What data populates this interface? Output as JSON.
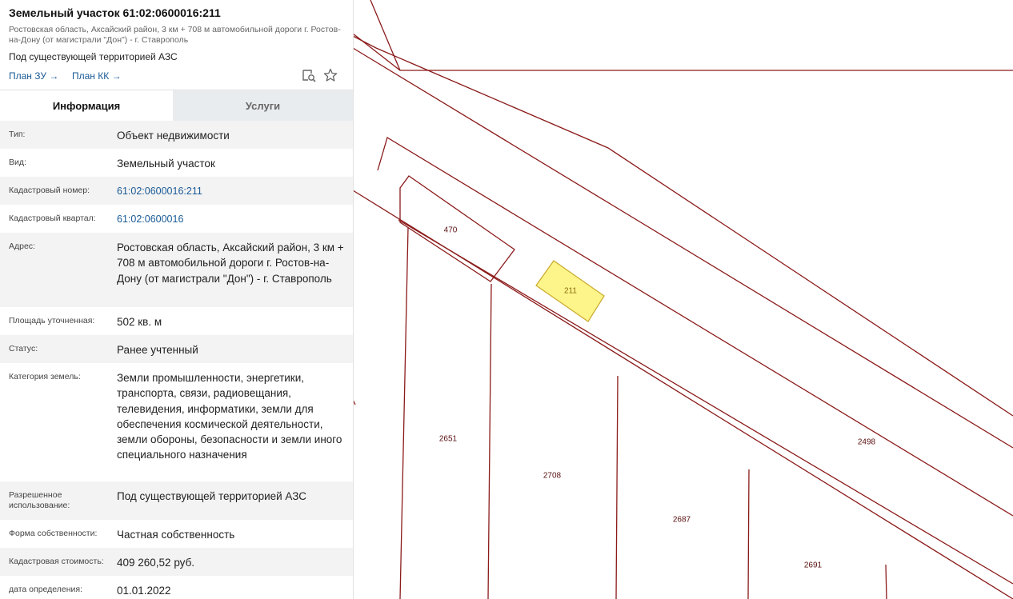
{
  "panel": {
    "title": "Земельный участок 61:02:0600016:211",
    "subaddress": "Ростовская область, Аксайский район, 3 км + 708 м автомобильной дороги г. Ростов-на-Дону (от магистрали \"Дон\") - г. Ставрополь",
    "usage": "Под существующей территорией АЗС",
    "links": [
      {
        "label": "План ЗУ →"
      },
      {
        "label": "План КК →"
      }
    ],
    "icons": [
      "map-search-icon",
      "star-icon"
    ],
    "tabs": [
      {
        "label": "Информация",
        "active": true
      },
      {
        "label": "Услуги",
        "active": false
      }
    ],
    "rows": [
      {
        "label": "Тип:",
        "value": "Объект недвижимости"
      },
      {
        "label": "Вид:",
        "value": "Земельный участок"
      },
      {
        "label": "Кадастровый номер:",
        "value": "61:02:0600016:211",
        "link": true
      },
      {
        "label": "Кадастровый квартал:",
        "value": "61:02:0600016",
        "link": true
      },
      {
        "label": "Адрес:",
        "value": "Ростовская область, Аксайский район, 3 км + 708 м автомобильной дороги г. Ростов-на-Дону (от магистрали \"Дон\") - г. Ставрополь"
      },
      {
        "label": "Площадь уточненная:",
        "value": "502 кв. м"
      },
      {
        "label": "Статус:",
        "value": "Ранее учтенный"
      },
      {
        "label": "Категория земель:",
        "value": "Земли промышленности, энергетики, транспорта, связи, радиовещания, телевидения, информатики, земли для обеспечения космической деятельности, земли обороны, безопасности и земли иного специального назначения"
      },
      {
        "label": "Разрешенное использование:",
        "value": "Под существующей территорией АЗС"
      },
      {
        "label": "Форма собственности:",
        "value": "Частная собственность"
      },
      {
        "label": "Кадастровая стоимость:",
        "value": "409 260,52 руб."
      },
      {
        "label": "дата определения:",
        "value": "01.01.2022"
      }
    ]
  },
  "map": {
    "parcel_labels": [
      "470",
      "211",
      "2651",
      "2708",
      "2498",
      "2687",
      "2691"
    ],
    "line_color": "#8b1a1a",
    "highlight_color": "#fdf58a"
  }
}
